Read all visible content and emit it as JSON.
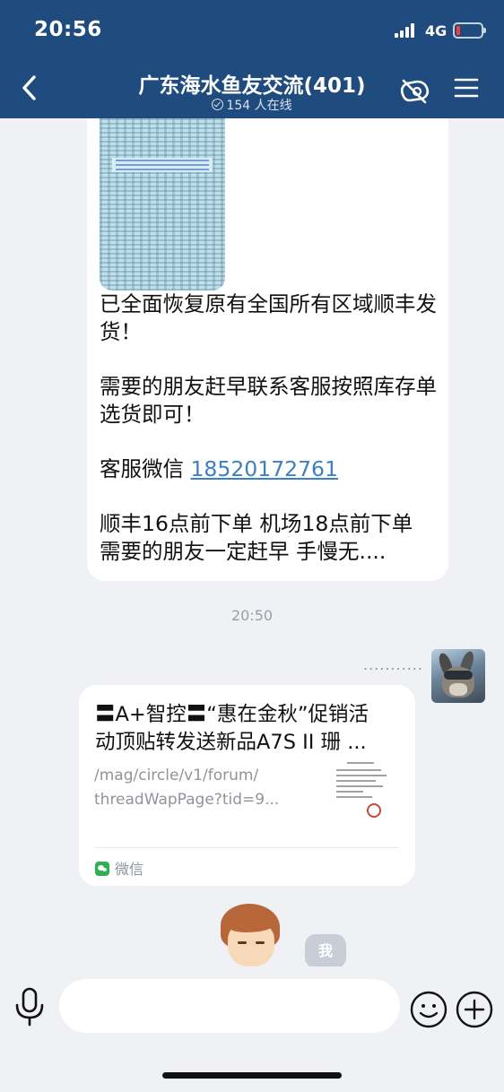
{
  "status_bar": {
    "time": "20:56",
    "network": "4G",
    "battery_level": 0.1
  },
  "header": {
    "title": "广东海水鱼友交流(401)",
    "online": "154 人在线",
    "icons": [
      "back-icon",
      "mute-icon",
      "menu-icon"
    ],
    "background": "#1f4b7e"
  },
  "messages": {
    "first": {
      "paragraphs": [
        "已全面恢复原有全国所有区域顺丰发货！",
        "需要的朋友赶早联系客服按照库存单选货即可！"
      ],
      "wechat_prefix": "客服微信 ",
      "wechat_number": "18520172761",
      "last_line": "顺丰16点前下单 机场18点前下单 需要的朋友一定赶早 手慢无...."
    },
    "timestamp": "20:50",
    "sender_name": "...........",
    "card": {
      "title_line1": "〓A+智控〓“惠在金秋”促销活",
      "title_line2": "动顶贴转发送新品A7S II 珊 ...",
      "url_line1": "/mag/circle/v1/forum/",
      "url_line2": "threadWapPage?tid=9...",
      "source": "微信"
    },
    "me_label": "我"
  },
  "input": {
    "placeholder": "",
    "icons": [
      "mic-icon",
      "emoji-icon",
      "plus-icon"
    ]
  },
  "colors": {
    "accent": "#1f4b7e",
    "link": "#3d7fc2",
    "chat_background": "#f0f1f5"
  }
}
